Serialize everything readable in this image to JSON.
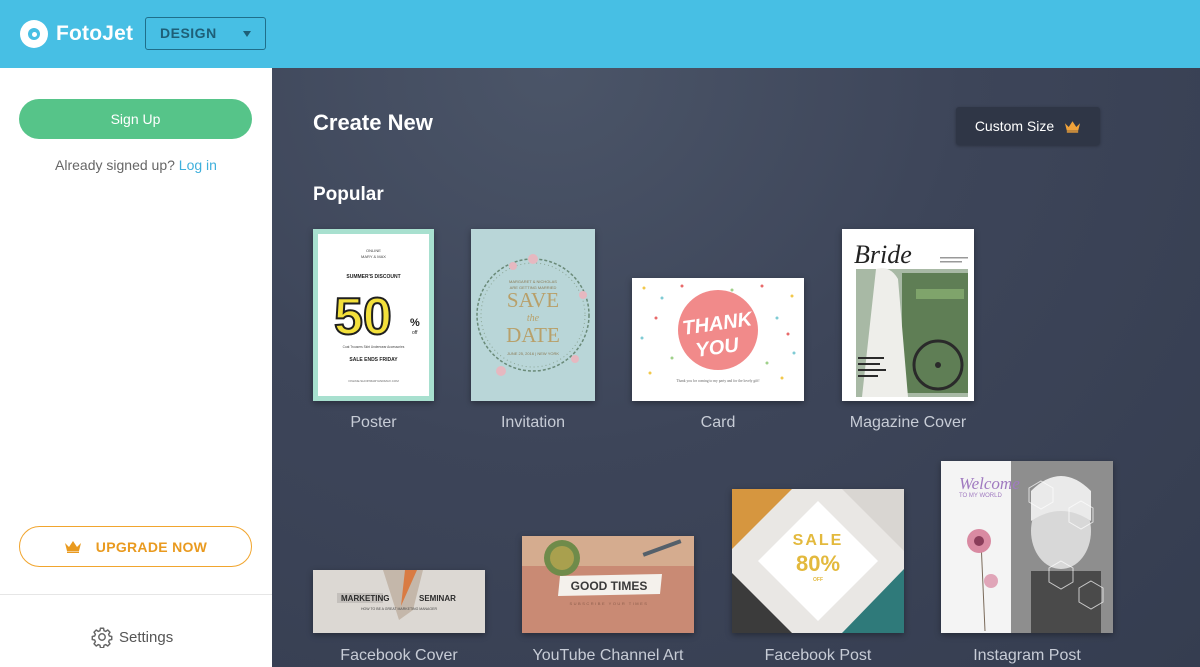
{
  "header": {
    "logo_text": "FotoJet",
    "design_select": {
      "value": "DESIGN"
    }
  },
  "sidebar": {
    "signup_label": "Sign Up",
    "already_text": "Already signed up?",
    "login_label": "Log in",
    "upgrade_label": "UPGRADE NOW",
    "settings_label": "Settings"
  },
  "main": {
    "create_title": "Create New",
    "custom_size_label": "Custom Size",
    "popular_title": "Popular",
    "templates": [
      {
        "label": "Poster"
      },
      {
        "label": "Invitation"
      },
      {
        "label": "Card"
      },
      {
        "label": "Magazine Cover"
      },
      {
        "label": "Facebook Cover"
      },
      {
        "label": "YouTube Channel Art"
      },
      {
        "label": "Facebook Post"
      },
      {
        "label": "Instagram Post"
      }
    ],
    "thumbs": {
      "poster": {
        "top1": "ONLINE",
        "top2": "MARY & MAX",
        "discount": "SUMMER'S DISCOUNT",
        "big": "50",
        "pct": "%",
        "off": "off",
        "cats": "Coat   Trousers   Skirt   Underwear   Accessories",
        "ends": "SALE ENDS FRIDAY",
        "url": "ONLINE.SHOP/MARYANDMAX.COM"
      },
      "invitation": {
        "names": "MARGARET & NICHOLAS",
        "sub": "ARE GETTING MARRIED",
        "save": "SAVE",
        "the": "the",
        "date": "DATE",
        "when": "JUNE 25, 2016 | NEW YORK"
      },
      "card": {
        "thank": "THANK",
        "you": "YOU",
        "msg": "Thank you for coming to my party and for the lovely gift!"
      },
      "magazine": {
        "title": "Bride"
      },
      "fb_cover": {
        "left": "MARKETING",
        "right": "SEMINAR",
        "sub": "HOW TO BE A GREAT MARKETING MANAGER"
      },
      "youtube": {
        "title": "GOOD TIMES",
        "sub": "SUBSCRIBE YOUR TIMES"
      },
      "fb_post": {
        "sale": "SALE",
        "pct": "80%",
        "off": "OFF"
      },
      "instagram": {
        "welcome": "Welcome",
        "world": "TO MY WORLD"
      }
    }
  },
  "colors": {
    "topbar": "#47bfe4",
    "signup": "#56c489",
    "upgrade": "#f1a52e",
    "link": "#3fb0dc",
    "main_bg": "#3d4559"
  }
}
